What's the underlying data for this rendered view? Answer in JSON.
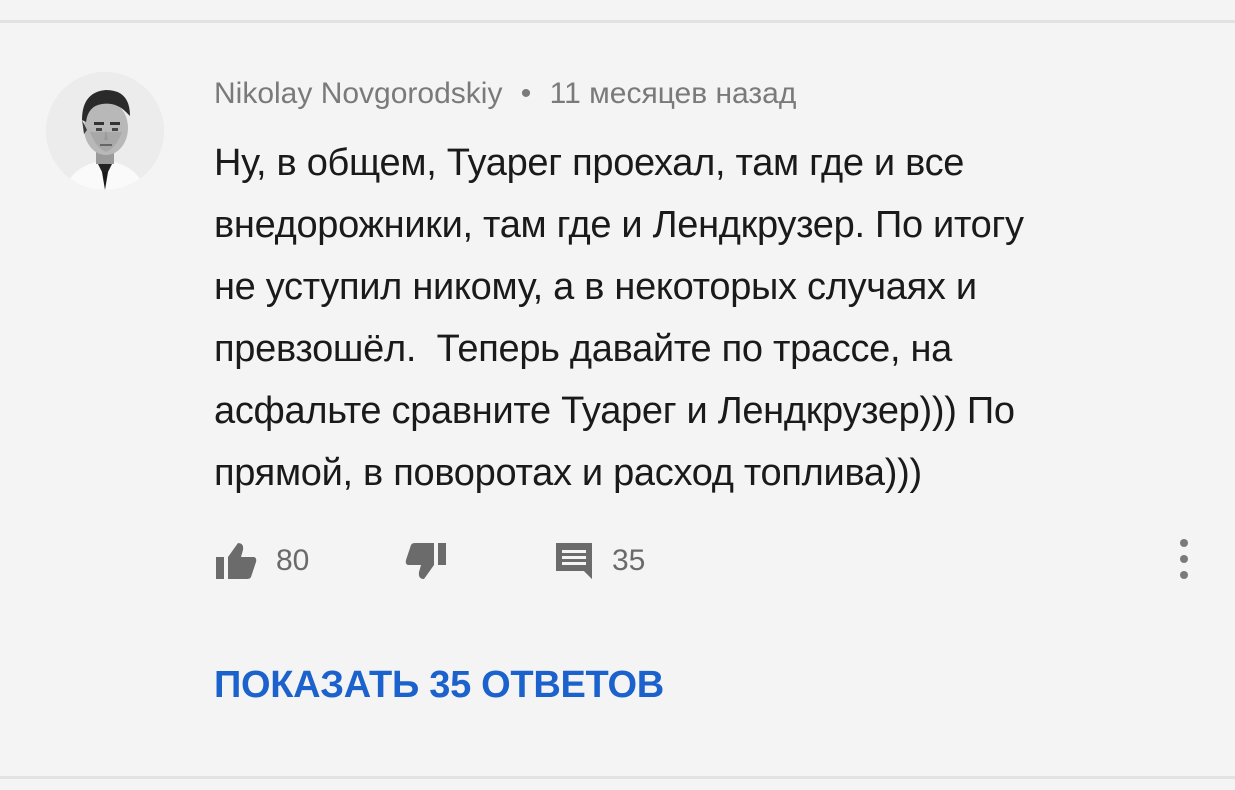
{
  "comment": {
    "author": "Nikolay Novgorodskiy",
    "separator": "•",
    "time": "11 месяцев назад",
    "text": "Ну, в общем, Туарег проехал, там где и все\nвнедорожники, там где и Лендкрузер. По итогу\nне уступил никому, а в некоторых случаях и\nпревзошёл.  Теперь давайте по трассе, на\nасфальте сравните Туарег и Лендкрузер))) По\nпрямой, в поворотах и расход топлива)))",
    "likes": "80",
    "replies_count": "35",
    "show_replies_label": "ПОКАЗАТЬ 35 ОТВЕТОВ"
  },
  "icons": {
    "like": "thumbs-up-icon",
    "dislike": "thumbs-down-icon",
    "reply": "comment-icon",
    "more": "more-vertical-icon"
  },
  "colors": {
    "background": "#f4f4f4",
    "link": "#1b62cc",
    "text": "#1a1a1a",
    "meta": "#7a7a7a"
  }
}
